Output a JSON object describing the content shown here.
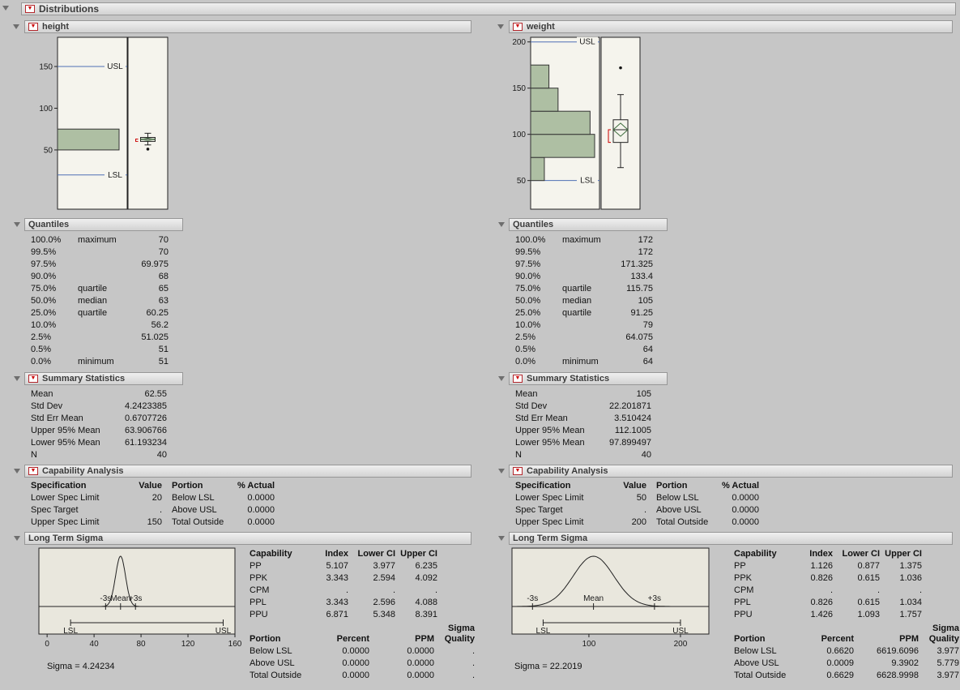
{
  "root_title": "Distributions",
  "height": {
    "title": "height",
    "quantiles": {
      "title": "Quantiles",
      "rows": [
        {
          "pct": "100.0%",
          "name": "maximum",
          "value": "70"
        },
        {
          "pct": "99.5%",
          "name": "",
          "value": "70"
        },
        {
          "pct": "97.5%",
          "name": "",
          "value": "69.975"
        },
        {
          "pct": "90.0%",
          "name": "",
          "value": "68"
        },
        {
          "pct": "75.0%",
          "name": "quartile",
          "value": "65"
        },
        {
          "pct": "50.0%",
          "name": "median",
          "value": "63"
        },
        {
          "pct": "25.0%",
          "name": "quartile",
          "value": "60.25"
        },
        {
          "pct": "10.0%",
          "name": "",
          "value": "56.2"
        },
        {
          "pct": "2.5%",
          "name": "",
          "value": "51.025"
        },
        {
          "pct": "0.5%",
          "name": "",
          "value": "51"
        },
        {
          "pct": "0.0%",
          "name": "minimum",
          "value": "51"
        }
      ]
    },
    "summary": {
      "title": "Summary Statistics",
      "rows": [
        {
          "label": "Mean",
          "value": "62.55"
        },
        {
          "label": "Std Dev",
          "value": "4.2423385"
        },
        {
          "label": "Std Err Mean",
          "value": "0.6707726"
        },
        {
          "label": "Upper 95% Mean",
          "value": "63.906766"
        },
        {
          "label": "Lower 95% Mean",
          "value": "61.193234"
        },
        {
          "label": "N",
          "value": "40"
        }
      ]
    },
    "capability": {
      "title": "Capability Analysis",
      "headers": {
        "spec": "Specification",
        "value": "Value",
        "portion": "Portion",
        "actual": "% Actual"
      },
      "rows": [
        {
          "spec": "Lower Spec Limit",
          "value": "20",
          "portion": "Below LSL",
          "actual": "0.0000"
        },
        {
          "spec": "Spec Target",
          "value": ".",
          "portion": "Above USL",
          "actual": "0.0000"
        },
        {
          "spec": "Upper Spec Limit",
          "value": "150",
          "portion": "Total Outside",
          "actual": "0.0000"
        }
      ]
    },
    "sigma": {
      "title": "Long Term Sigma",
      "sigma_label": "Sigma = 4.24234",
      "cap_headers": {
        "c0": "Capability",
        "c1": "Index",
        "c2": "Lower CI",
        "c3": "Upper CI"
      },
      "cap_rows": [
        {
          "c0": "PP",
          "c1": "5.107",
          "c2": "3.977",
          "c3": "6.235"
        },
        {
          "c0": "PPK",
          "c1": "3.343",
          "c2": "2.594",
          "c3": "4.092"
        },
        {
          "c0": "CPM",
          "c1": ".",
          "c2": ".",
          "c3": "."
        },
        {
          "c0": "PPL",
          "c1": "3.343",
          "c2": "2.596",
          "c3": "4.088"
        },
        {
          "c0": "PPU",
          "c1": "6.871",
          "c2": "5.348",
          "c3": "8.391"
        }
      ],
      "portion_headers": {
        "line1_c3": "Sigma",
        "c0": "Portion",
        "c1": "Percent",
        "c2": "PPM",
        "c3": "Quality"
      },
      "portion_rows": [
        {
          "c0": "Below LSL",
          "c1": "0.0000",
          "c2": "0.0000",
          "c3": "."
        },
        {
          "c0": "Above USL",
          "c1": "0.0000",
          "c2": "0.0000",
          "c3": "."
        },
        {
          "c0": "Total Outside",
          "c1": "0.0000",
          "c2": "0.0000",
          "c3": "."
        }
      ]
    }
  },
  "weight": {
    "title": "weight",
    "quantiles": {
      "title": "Quantiles",
      "rows": [
        {
          "pct": "100.0%",
          "name": "maximum",
          "value": "172"
        },
        {
          "pct": "99.5%",
          "name": "",
          "value": "172"
        },
        {
          "pct": "97.5%",
          "name": "",
          "value": "171.325"
        },
        {
          "pct": "90.0%",
          "name": "",
          "value": "133.4"
        },
        {
          "pct": "75.0%",
          "name": "quartile",
          "value": "115.75"
        },
        {
          "pct": "50.0%",
          "name": "median",
          "value": "105"
        },
        {
          "pct": "25.0%",
          "name": "quartile",
          "value": "91.25"
        },
        {
          "pct": "10.0%",
          "name": "",
          "value": "79"
        },
        {
          "pct": "2.5%",
          "name": "",
          "value": "64.075"
        },
        {
          "pct": "0.5%",
          "name": "",
          "value": "64"
        },
        {
          "pct": "0.0%",
          "name": "minimum",
          "value": "64"
        }
      ]
    },
    "summary": {
      "title": "Summary Statistics",
      "rows": [
        {
          "label": "Mean",
          "value": "105"
        },
        {
          "label": "Std Dev",
          "value": "22.201871"
        },
        {
          "label": "Std Err Mean",
          "value": "3.510424"
        },
        {
          "label": "Upper 95% Mean",
          "value": "112.1005"
        },
        {
          "label": "Lower 95% Mean",
          "value": "97.899497"
        },
        {
          "label": "N",
          "value": "40"
        }
      ]
    },
    "capability": {
      "title": "Capability Analysis",
      "headers": {
        "spec": "Specification",
        "value": "Value",
        "portion": "Portion",
        "actual": "% Actual"
      },
      "rows": [
        {
          "spec": "Lower Spec Limit",
          "value": "50",
          "portion": "Below LSL",
          "actual": "0.0000"
        },
        {
          "spec": "Spec Target",
          "value": ".",
          "portion": "Above USL",
          "actual": "0.0000"
        },
        {
          "spec": "Upper Spec Limit",
          "value": "200",
          "portion": "Total Outside",
          "actual": "0.0000"
        }
      ]
    },
    "sigma": {
      "title": "Long Term Sigma",
      "sigma_label": "Sigma = 22.2019",
      "cap_headers": {
        "c0": "Capability",
        "c1": "Index",
        "c2": "Lower CI",
        "c3": "Upper CI"
      },
      "cap_rows": [
        {
          "c0": "PP",
          "c1": "1.126",
          "c2": "0.877",
          "c3": "1.375"
        },
        {
          "c0": "PPK",
          "c1": "0.826",
          "c2": "0.615",
          "c3": "1.036"
        },
        {
          "c0": "CPM",
          "c1": ".",
          "c2": ".",
          "c3": "."
        },
        {
          "c0": "PPL",
          "c1": "0.826",
          "c2": "0.615",
          "c3": "1.034"
        },
        {
          "c0": "PPU",
          "c1": "1.426",
          "c2": "1.093",
          "c3": "1.757"
        }
      ],
      "portion_headers": {
        "line1_c3": "Sigma",
        "c0": "Portion",
        "c1": "Percent",
        "c2": "PPM",
        "c3": "Quality"
      },
      "portion_rows": [
        {
          "c0": "Below LSL",
          "c1": "0.6620",
          "c2": "6619.6096",
          "c3": "3.977"
        },
        {
          "c0": "Above USL",
          "c1": "0.0009",
          "c2": "9.3902",
          "c3": "5.779"
        },
        {
          "c0": "Total Outside",
          "c1": "0.6629",
          "c2": "6628.9998",
          "c3": "3.977"
        }
      ]
    }
  },
  "chart_data": [
    {
      "id": "height-histogram",
      "type": "bar",
      "variable": "height",
      "orientation": "horizontal-bars",
      "axis": {
        "min": -21,
        "max": 185,
        "ticks": [
          50,
          100,
          150
        ]
      },
      "bins": [
        {
          "lo": 50,
          "hi": 75,
          "count": 40
        }
      ],
      "spec_limits": {
        "lsl": 20,
        "usl": 150
      },
      "labels": {
        "usl": "USL",
        "lsl": "LSL"
      },
      "box": {
        "whisker_low": 56,
        "q1": 60.25,
        "median": 63,
        "q3": 65,
        "whisker_high": 70,
        "mean": 62.55,
        "ci_low": 61.193234,
        "ci_high": 63.906766,
        "outliers": [
          51
        ]
      }
    },
    {
      "id": "weight-histogram",
      "type": "bar",
      "variable": "weight",
      "orientation": "horizontal-bars",
      "axis": {
        "min": 19,
        "max": 205,
        "ticks": [
          50,
          100,
          150,
          200
        ]
      },
      "bins": [
        {
          "lo": 50,
          "hi": 75,
          "count": 3
        },
        {
          "lo": 75,
          "hi": 100,
          "count": 14
        },
        {
          "lo": 100,
          "hi": 125,
          "count": 13
        },
        {
          "lo": 125,
          "hi": 150,
          "count": 6
        },
        {
          "lo": 150,
          "hi": 175,
          "count": 4
        }
      ],
      "spec_limits": {
        "lsl": 50,
        "usl": 200
      },
      "labels": {
        "usl": "USL",
        "lsl": "LSL"
      },
      "box": {
        "whisker_low": 64,
        "q1": 91.25,
        "median": 105,
        "q3": 115.75,
        "whisker_high": 143,
        "mean": 105,
        "ci_low": 97.899497,
        "ci_high": 112.1005,
        "outliers": [
          172
        ]
      }
    },
    {
      "id": "height-capability-curve",
      "type": "line",
      "variable": "height",
      "mean": 62.55,
      "sigma": 4.24234,
      "lsl": 20,
      "usl": 150,
      "axis": {
        "min": -7,
        "max": 160,
        "ticks": [
          0,
          40,
          80,
          120,
          160
        ]
      },
      "labels": {
        "minus3s": "-3s",
        "mean": "Mean",
        "plus3s": "+3s",
        "lsl": "LSL",
        "usl": "USL"
      }
    },
    {
      "id": "weight-capability-curve",
      "type": "line",
      "variable": "weight",
      "mean": 105,
      "sigma": 22.2019,
      "lsl": 50,
      "usl": 200,
      "axis": {
        "min": 16,
        "max": 231,
        "ticks": [
          100,
          200
        ]
      },
      "labels": {
        "minus3s": "-3s",
        "mean": "Mean",
        "plus3s": "+3s",
        "lsl": "LSL",
        "usl": "USL"
      }
    }
  ]
}
